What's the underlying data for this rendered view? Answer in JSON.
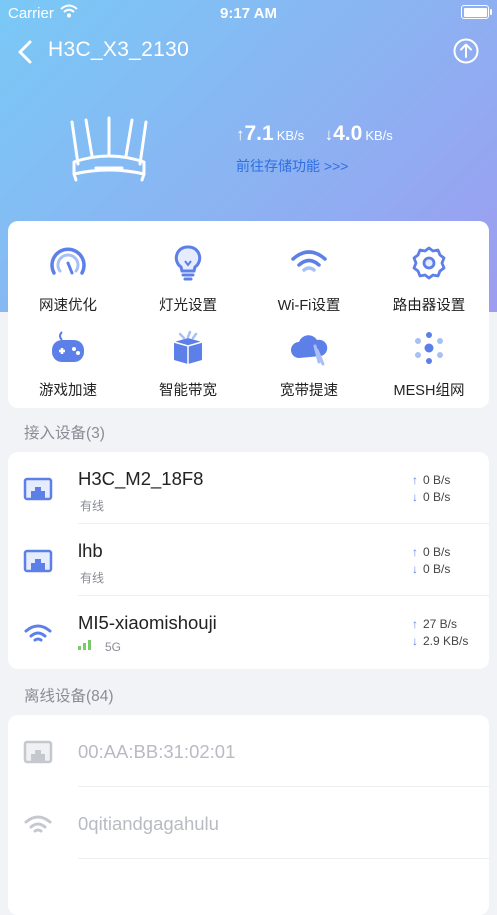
{
  "status_bar": {
    "carrier": "Carrier",
    "time": "9:17 AM"
  },
  "nav": {
    "title": "H3C_X3_2130"
  },
  "hero": {
    "upload_speed": "7.1",
    "upload_unit": "KB/s",
    "download_speed": "4.0",
    "download_unit": "KB/s",
    "storage_link": "前往存储功能 >>>"
  },
  "features": [
    {
      "label": "网速优化",
      "icon": "speedometer-icon"
    },
    {
      "label": "灯光设置",
      "icon": "lightbulb-icon"
    },
    {
      "label": "Wi-Fi设置",
      "icon": "wifi-icon"
    },
    {
      "label": "路由器设置",
      "icon": "gear-icon"
    },
    {
      "label": "游戏加速",
      "icon": "gamepad-icon"
    },
    {
      "label": "智能带宽",
      "icon": "box-icon"
    },
    {
      "label": "宽带提速",
      "icon": "cloud-rocket-icon"
    },
    {
      "label": "MESH组网",
      "icon": "mesh-icon"
    }
  ],
  "connected": {
    "title": "接入设备(3)",
    "devices": [
      {
        "name": "H3C_M2_18F8",
        "type": "有线",
        "up": "0 B/s",
        "down": "0 B/s",
        "icon": "ethernet-icon"
      },
      {
        "name": "lhb",
        "type": "有线",
        "up": "0 B/s",
        "down": "0 B/s",
        "icon": "ethernet-icon"
      },
      {
        "name": "MI5-xiaomishouji",
        "band": "5G",
        "up": "27 B/s",
        "down": "2.9 KB/s",
        "icon": "wifi-icon"
      }
    ]
  },
  "offline": {
    "title": "离线设备(84)",
    "devices": [
      {
        "name": "00:AA:BB:31:02:01",
        "icon": "ethernet-icon"
      },
      {
        "name": "0qitiandgagahulu",
        "icon": "wifi-icon"
      }
    ]
  },
  "colors": {
    "accent": "#2f6fe0",
    "icon_blue": "#5d7fe8",
    "hero_start": "#79c9f6",
    "hero_end": "#9d9cf0"
  }
}
